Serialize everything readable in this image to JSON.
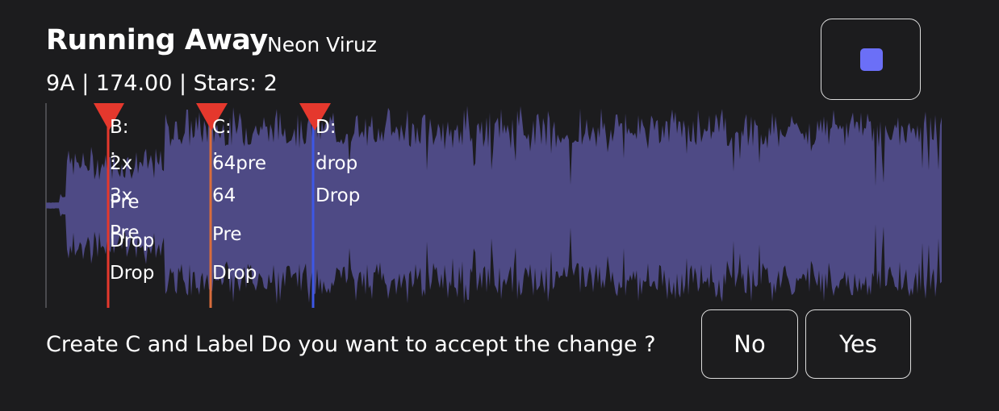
{
  "track": {
    "title": "Running Away",
    "artist": "Neon Viruz",
    "meta": "9A | 174.00 | Stars: 2"
  },
  "player": {
    "stop_icon": "stop-icon",
    "accent_color": "#6b6ff7"
  },
  "waveform": {
    "fill_color": "#4e4a85",
    "cues": [
      {
        "name": "B",
        "color": "#e5382d",
        "line_color": "#e5382d",
        "labels": [
          "B:",
          ":",
          "2x",
          "3x",
          "Pre",
          "Pre",
          "Drop",
          "Drop"
        ]
      },
      {
        "name": "C",
        "color": "#e5382d",
        "line_color": "#d86c3c",
        "labels": [
          "C:",
          ":",
          "64pre",
          "64",
          "Pre",
          "Drop"
        ]
      },
      {
        "name": "D",
        "color": "#e5382d",
        "line_color": "#3d57e6",
        "labels": [
          "D:",
          ":",
          "drop",
          "Drop"
        ]
      }
    ]
  },
  "dialog": {
    "prompt": "Create C and Label Do you want to accept the change ?",
    "no_label": "No",
    "yes_label": "Yes"
  }
}
